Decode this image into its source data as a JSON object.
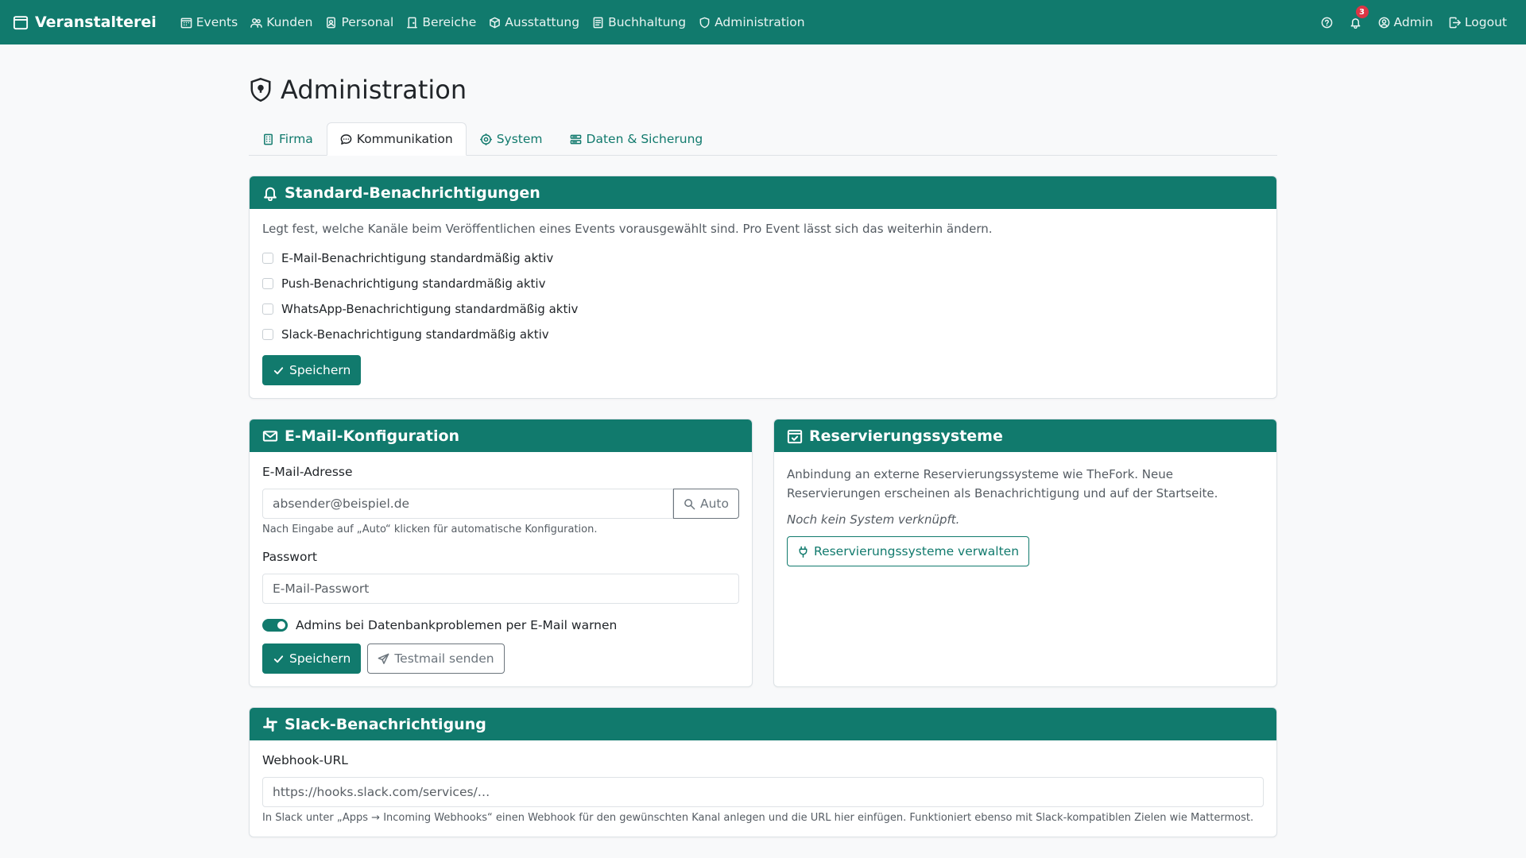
{
  "nav": {
    "brand": "Veranstalterei",
    "links": [
      {
        "label": "Events"
      },
      {
        "label": "Kunden"
      },
      {
        "label": "Personal"
      },
      {
        "label": "Bereiche"
      },
      {
        "label": "Ausstattung"
      },
      {
        "label": "Buchhaltung"
      },
      {
        "label": "Administration"
      }
    ],
    "notification_count": "3",
    "user": "Admin",
    "logout": "Logout"
  },
  "page": {
    "title": "Administration",
    "tabs": [
      {
        "label": "Firma"
      },
      {
        "label": "Kommunikation"
      },
      {
        "label": "System"
      },
      {
        "label": "Daten & Sicherung"
      }
    ]
  },
  "notifications": {
    "title": "Standard-Benachrichtigungen",
    "description": "Legt fest, welche Kanäle beim Veröffentlichen eines Events vorausgewählt sind. Pro Event lässt sich das weiterhin ändern.",
    "options": [
      {
        "label": "E-Mail-Benachrichtigung standardmäßig aktiv"
      },
      {
        "label": "Push-Benachrichtigung standardmäßig aktiv"
      },
      {
        "label": "WhatsApp-Benachrichtigung standardmäßig aktiv"
      },
      {
        "label": "Slack-Benachrichtigung standardmäßig aktiv"
      }
    ],
    "save_label": "Speichern"
  },
  "email": {
    "title": "E-Mail-Konfiguration",
    "address_label": "E-Mail-Adresse",
    "address_placeholder": "absender@beispiel.de",
    "auto_label": "Auto",
    "address_help": "Nach Eingabe auf „Auto“ klicken für automatische Konfiguration.",
    "password_label": "Passwort",
    "password_placeholder": "E-Mail-Passwort",
    "warn_label": "Admins bei Datenbankproblemen per E-Mail warnen",
    "save_label": "Speichern",
    "test_label": "Testmail senden"
  },
  "reservations": {
    "title": "Reservierungssysteme",
    "description": "Anbindung an externe Reservierungssysteme wie TheFork. Neue Reservierungen erscheinen als Benachrichtigung und auf der Startseite.",
    "empty": "Noch kein System verknüpft.",
    "manage_label": "Reservierungssysteme verwalten"
  },
  "slack": {
    "title": "Slack-Benachrichtigung",
    "webhook_label": "Webhook-URL",
    "webhook_placeholder": "https://hooks.slack.com/services/…",
    "help": "In Slack unter „Apps → Incoming Webhooks“ einen Webhook für den gewünschten Kanal anlegen und die URL hier einfügen. Funktioniert ebenso mit Slack-kompatiblen Zielen wie Mattermost."
  },
  "colors": {
    "primary": "#117a6d",
    "badge": "#dc3545"
  }
}
